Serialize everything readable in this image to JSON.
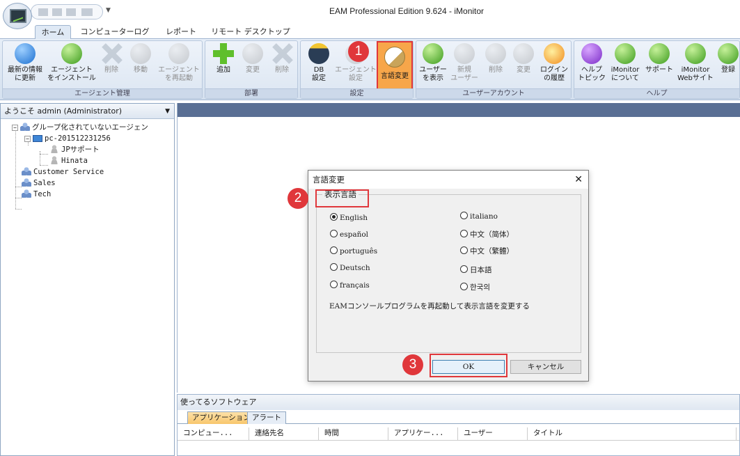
{
  "window": {
    "title": "EAM Professional Edition 9.624 - iMonitor"
  },
  "tabs": [
    "ホーム",
    "コンピューターログ",
    "レポート",
    "リモート デスクトップ"
  ],
  "ribbon": {
    "groups": [
      {
        "label": "エージェント管理",
        "buttons": [
          {
            "label": "最新の情報\nに更新",
            "icon": "refresh-icon",
            "dropdown": true
          },
          {
            "label": "エージェント\nをインストール",
            "icon": "install-agent-icon"
          },
          {
            "label": "削除",
            "icon": "delete-icon",
            "disabled": true
          },
          {
            "label": "移動",
            "icon": "move-icon",
            "disabled": true
          },
          {
            "label": "エージェント\nを再起動",
            "icon": "restart-agent-icon",
            "disabled": true
          }
        ]
      },
      {
        "label": "部署",
        "buttons": [
          {
            "label": "追加",
            "icon": "add-icon"
          },
          {
            "label": "変更",
            "icon": "edit-icon",
            "disabled": true
          },
          {
            "label": "削除",
            "icon": "delete-icon",
            "disabled": true
          }
        ]
      },
      {
        "label": "設定",
        "buttons": [
          {
            "label": "DB\n設定",
            "icon": "database-icon",
            "dropdown": true
          },
          {
            "label": "エージェント\n設定",
            "icon": "agent-settings-icon",
            "disabled": true
          },
          {
            "label": "言語変更",
            "icon": "language-icon",
            "highlighted": true
          }
        ]
      },
      {
        "label": "ユーザーアカウント",
        "buttons": [
          {
            "label": "ユーザー\nを表示",
            "icon": "users-icon"
          },
          {
            "label": "新規\nユーザー",
            "icon": "new-user-icon",
            "disabled": true
          },
          {
            "label": "削除",
            "icon": "delete-user-icon",
            "disabled": true
          },
          {
            "label": "変更",
            "icon": "edit-user-icon",
            "disabled": true
          },
          {
            "label": "ログイン\nの履歴",
            "icon": "login-history-icon"
          }
        ]
      },
      {
        "label": "ヘルプ",
        "buttons": [
          {
            "label": "ヘルプ\nトピック",
            "icon": "help-icon"
          },
          {
            "label": "iMonitor\nについて",
            "icon": "about-icon"
          },
          {
            "label": "サポート",
            "icon": "support-icon"
          },
          {
            "label": "iMonitor\nWebサイト",
            "icon": "website-icon"
          },
          {
            "label": "登録",
            "icon": "register-icon"
          }
        ]
      }
    ]
  },
  "left_panel": {
    "header": "ようこそ admin (Administrator)",
    "tree": {
      "root": "グループ化されていないエージェン",
      "pc": "pc-201512231256",
      "users": [
        "JPサポート",
        "Hinata"
      ],
      "groups": [
        "Customer Service",
        "Sales",
        "Tech"
      ]
    }
  },
  "bottom_panel": {
    "title": "使ってるソフトウェア",
    "tabs": [
      "アプリケーション",
      "アラート"
    ],
    "columns": [
      "コンピュー...",
      "連絡先名",
      "時間",
      "アプリケー...",
      "ユーザー",
      "タイトル"
    ]
  },
  "dialog": {
    "title": "言語変更",
    "close": "✕",
    "group_label": "表示言語",
    "languages_left": [
      "English",
      "español",
      "português",
      "Deutsch",
      "français"
    ],
    "languages_right": [
      "italiano",
      "中文（简体）",
      "中文（繁體）",
      "日本語",
      "한국의"
    ],
    "selected": "English",
    "note": "EAMコンソールプログラムを再起動して表示言語を変更する",
    "ok_label": "OK",
    "cancel_label": "キャンセル"
  },
  "annotations": [
    "1",
    "2",
    "3"
  ],
  "colors": {
    "accent_red": "#e0373b",
    "highlight_orange": "#f7a64a",
    "panel_bar": "#5a6f94"
  }
}
